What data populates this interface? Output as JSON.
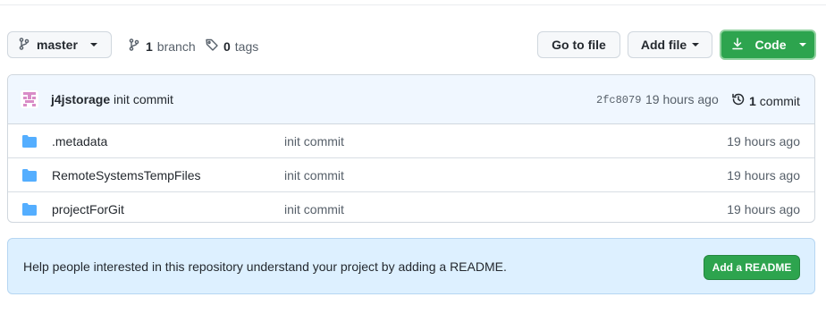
{
  "toolbar": {
    "branch_label": "master",
    "branches_count": "1",
    "branches_label": "branch",
    "tags_count": "0",
    "tags_label": "tags",
    "goto_label": "Go to file",
    "addfile_label": "Add file",
    "code_label": "Code"
  },
  "commit": {
    "author": "j4jstorage",
    "message": "init commit",
    "sha": "2fc8079",
    "time": "19 hours ago",
    "count": "1",
    "count_label": "commit"
  },
  "files": [
    {
      "name": ".metadata",
      "message": "init commit",
      "time": "19 hours ago"
    },
    {
      "name": "RemoteSystemsTempFiles",
      "message": "init commit",
      "time": "19 hours ago"
    },
    {
      "name": "projectForGit",
      "message": "init commit",
      "time": "19 hours ago"
    }
  ],
  "readme": {
    "text": "Help people interested in this repository understand your project by adding a README.",
    "button_label": "Add a README"
  },
  "colors": {
    "accent_green": "#2da44e",
    "folder_blue": "#54aeff",
    "readme_bg": "#ddf0ff"
  },
  "icons": [
    "branch-icon",
    "tag-icon",
    "download-icon",
    "history-icon",
    "folder-icon",
    "avatar-identicon"
  ]
}
